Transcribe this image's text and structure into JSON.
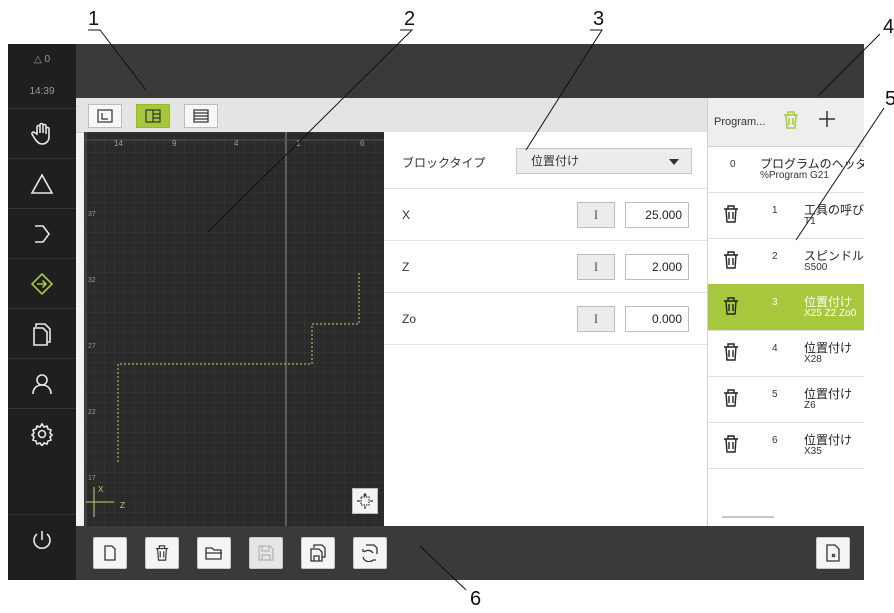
{
  "callouts": [
    "1",
    "2",
    "3",
    "4",
    "5",
    "6"
  ],
  "status": {
    "warnings": "△ 0",
    "time": "14:39"
  },
  "sidebar": {
    "items": [
      {
        "icon": "hand-icon"
      },
      {
        "icon": "triangle-icon"
      },
      {
        "icon": "arrow-right-icon"
      },
      {
        "icon": "program-run-icon",
        "active": true
      },
      {
        "icon": "documents-icon"
      },
      {
        "icon": "user-icon"
      },
      {
        "icon": "settings-icon"
      },
      {
        "icon": "power-icon"
      }
    ]
  },
  "view_buttons": [
    {
      "icon": "graphic-view-icon"
    },
    {
      "icon": "split-view-icon",
      "active": true
    },
    {
      "icon": "list-view-icon"
    }
  ],
  "graphic": {
    "ruler_top": [
      "14",
      "9",
      "4",
      "1",
      "6"
    ],
    "ruler_left": [
      "37",
      "32",
      "27",
      "22",
      "17"
    ],
    "axis_x": "X",
    "axis_z": "Z"
  },
  "form": {
    "block_type_label": "ブロックタイプ",
    "block_type_value": "位置付け",
    "rows": [
      {
        "label": "X",
        "btn": "I",
        "value": "25.000"
      },
      {
        "label": "Z",
        "btn": "I",
        "value": "2.000"
      },
      {
        "label": "Zo",
        "btn": "I",
        "value": "0.000"
      }
    ]
  },
  "program": {
    "title": "Program...",
    "rows": [
      {
        "num": "0",
        "name": "プログラムのヘッダ",
        "code": "%Program G21",
        "trash": false
      },
      {
        "num": "1",
        "name": "工具の呼び",
        "code": "T1",
        "trash": true
      },
      {
        "num": "2",
        "name": "スピンドル",
        "code": "S500",
        "trash": true
      },
      {
        "num": "3",
        "name": "位置付け",
        "code": "X25 Z2 Zo0",
        "trash": true,
        "selected": true
      },
      {
        "num": "4",
        "name": "位置付け",
        "code": "X28",
        "trash": true
      },
      {
        "num": "5",
        "name": "位置付け",
        "code": "Z6",
        "trash": true
      },
      {
        "num": "6",
        "name": "位置付け",
        "code": "X35",
        "trash": true
      }
    ]
  },
  "bottom_buttons": [
    {
      "icon": "new-file-icon"
    },
    {
      "icon": "delete-icon"
    },
    {
      "icon": "open-folder-icon"
    },
    {
      "icon": "save-icon",
      "disabled": true
    },
    {
      "icon": "save-as-icon"
    },
    {
      "icon": "sync-icon"
    },
    {
      "icon": "close-program-icon"
    }
  ],
  "colors": {
    "accent": "#a7c83c",
    "sidebar": "#1f1f1f",
    "bar": "#3a3a3a"
  }
}
